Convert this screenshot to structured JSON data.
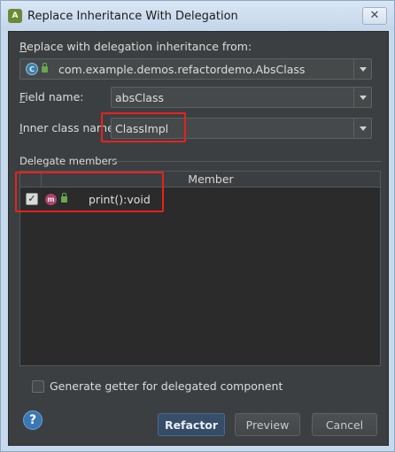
{
  "window": {
    "title": "Replace Inheritance With Delegation",
    "app_icon": "android-studio-icon",
    "close_glyph": "✕"
  },
  "form": {
    "replace_label": "Replace with delegation inheritance from:",
    "replace_label_mnemonic": "R",
    "replace_label_rest": "eplace with delegation inheritance from:",
    "class_value": "com.example.demos.refactordemo.AbsClass",
    "class_icon_letter": "C",
    "field_label_mnemonic": "F",
    "field_label_rest": "ield name:",
    "field_value": "absClass",
    "inner_label_mnemonic": "I",
    "inner_label_rest": "nner class name:",
    "inner_value": "ClassImpl"
  },
  "delegate": {
    "section_label": "Delegate members",
    "column_header": "Member",
    "rows": [
      {
        "checked": true,
        "icon_letter": "m",
        "label": "print():void"
      }
    ]
  },
  "generate": {
    "label_pre": "Generate ",
    "label_mnemonic": "g",
    "label_post": "etter for delegated component",
    "checked": false
  },
  "buttons": {
    "help": "?",
    "refactor": "Refactor",
    "preview": "Preview",
    "cancel": "Cancel"
  },
  "colors": {
    "highlight": "#e8211d",
    "dialog_bg": "#3c3f41",
    "table_bg": "#2b2b2b"
  }
}
